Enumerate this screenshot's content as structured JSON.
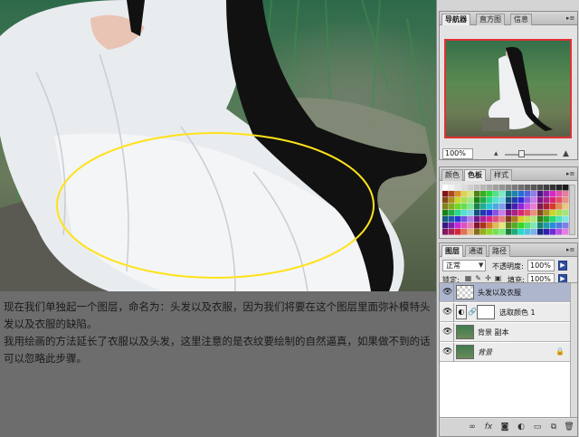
{
  "caption": {
    "line1": "现在我们单独起一个图层，命名为：头发以及衣服，因为我们将要在这个图层里面弥补模特头发以及衣服的缺陷。",
    "line2": "我用绘画的方法延长了衣服以及头发，这里注意的是衣纹要绘制的自然逼真，如果做不到的话可以忽略此步骤。"
  },
  "navigator": {
    "tabs": [
      "导航器",
      "直方图",
      "信息"
    ],
    "zoom": "100%"
  },
  "swatches": {
    "tabs": [
      "颜色",
      "色板",
      "样式"
    ]
  },
  "layers": {
    "tabs": [
      "图层",
      "通道",
      "路径"
    ],
    "blend_mode": "正常",
    "opacity_label": "不透明度:",
    "opacity": "100%",
    "lock_label": "锁定:",
    "fill_label": "填充:",
    "fill": "100%",
    "items": [
      {
        "name": "头发以及衣服",
        "selected": true
      },
      {
        "name": "选取颜色 1",
        "selected": false
      },
      {
        "name": "背景 副本",
        "selected": false
      },
      {
        "name": "背景",
        "selected": false
      }
    ]
  },
  "icons": {
    "eye": "eye-icon",
    "lock": "lock-icon",
    "link": "link-icon",
    "fx": "fx-icon",
    "mask": "mask-icon",
    "adjustment": "adjustment-icon",
    "folder": "folder-icon",
    "new_layer": "new-layer-icon",
    "trash": "trash-icon"
  },
  "colors": {
    "selection_ellipse": "#ffe21a",
    "navigator_frame": "#e03232",
    "selected_layer": "#aeb6ce"
  }
}
